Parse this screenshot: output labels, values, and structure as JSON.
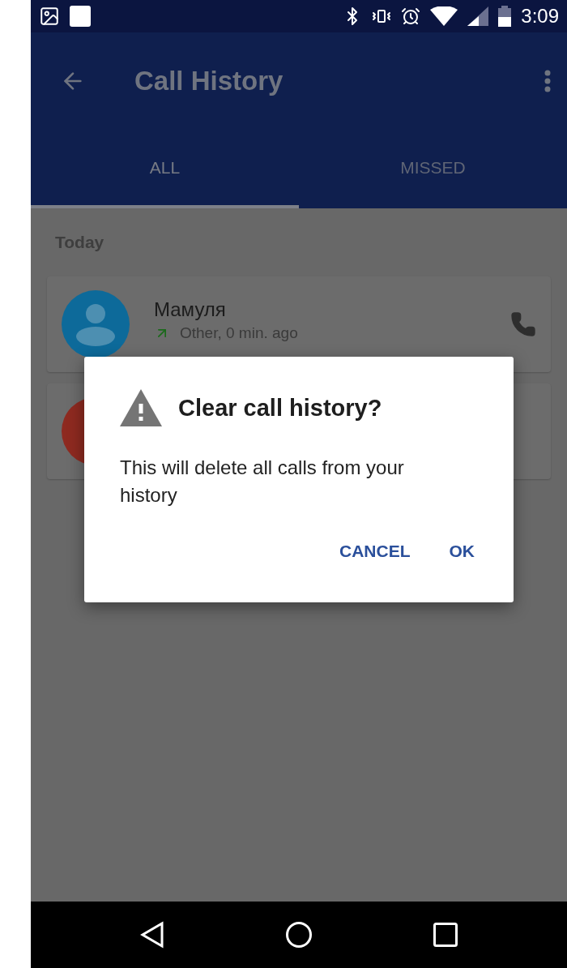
{
  "status_bar": {
    "time": "3:09"
  },
  "app_bar": {
    "title": "Call History"
  },
  "tabs": [
    {
      "label": "ALL",
      "selected": true
    },
    {
      "label": "MISSED",
      "selected": false
    }
  ],
  "section": "Today",
  "calls": [
    {
      "name": "Мамуля",
      "detail": "Other, 0 min. ago",
      "color": "#0d6a9a"
    },
    {
      "color": "#8e2a20"
    }
  ],
  "dialog": {
    "title": "Clear call history?",
    "message": "This will delete all calls from your history",
    "buttons": [
      "CANCEL",
      "OK"
    ]
  }
}
